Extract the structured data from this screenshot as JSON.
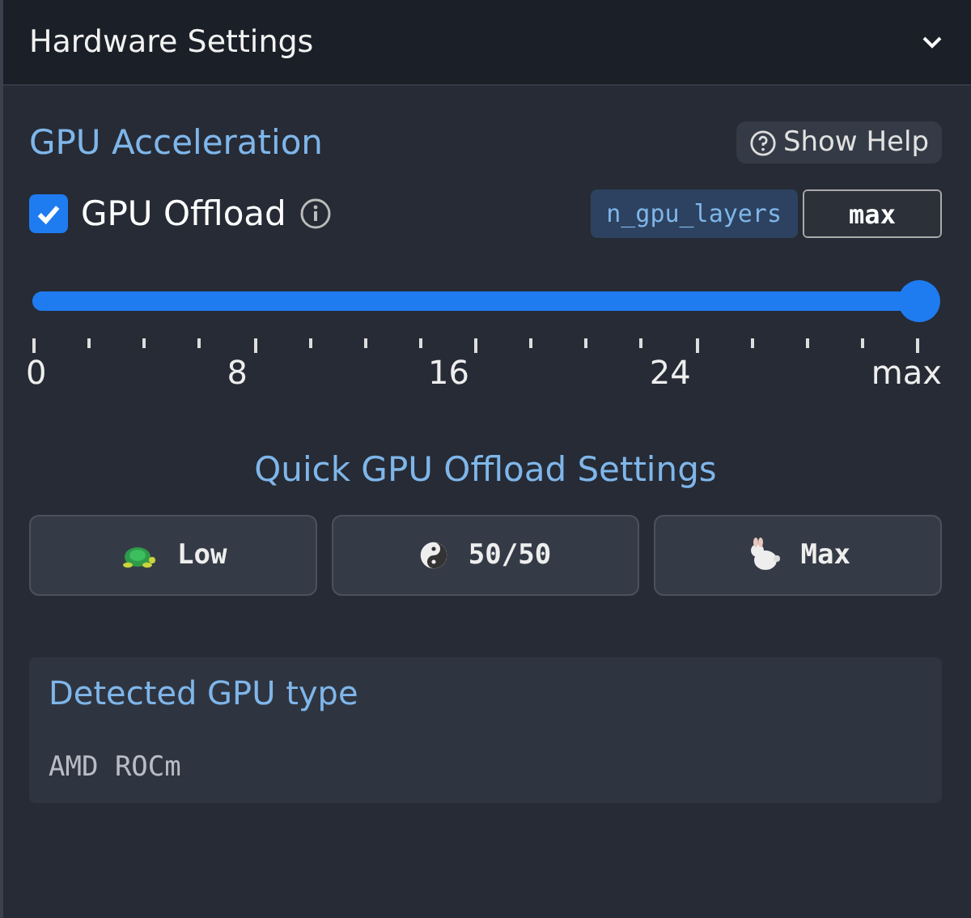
{
  "panel": {
    "title": "Hardware Settings",
    "expanded": true
  },
  "section": {
    "title": "GPU Acceleration",
    "help_button": "Show Help"
  },
  "offload": {
    "label": "GPU Offload",
    "checked": true,
    "param_name": "n_gpu_layers",
    "param_value": "max"
  },
  "slider": {
    "level": 1,
    "labels": [
      "0",
      "8",
      "16",
      "24",
      "max"
    ]
  },
  "quick": {
    "title": "Quick GPU Offload Settings",
    "buttons": [
      {
        "kind": "turtle",
        "label": "Low"
      },
      {
        "kind": "yinyang",
        "label": "50/50"
      },
      {
        "kind": "rabbit",
        "label": "Max"
      }
    ]
  },
  "detected": {
    "title": "Detected GPU type",
    "value": "AMD ROCm"
  }
}
